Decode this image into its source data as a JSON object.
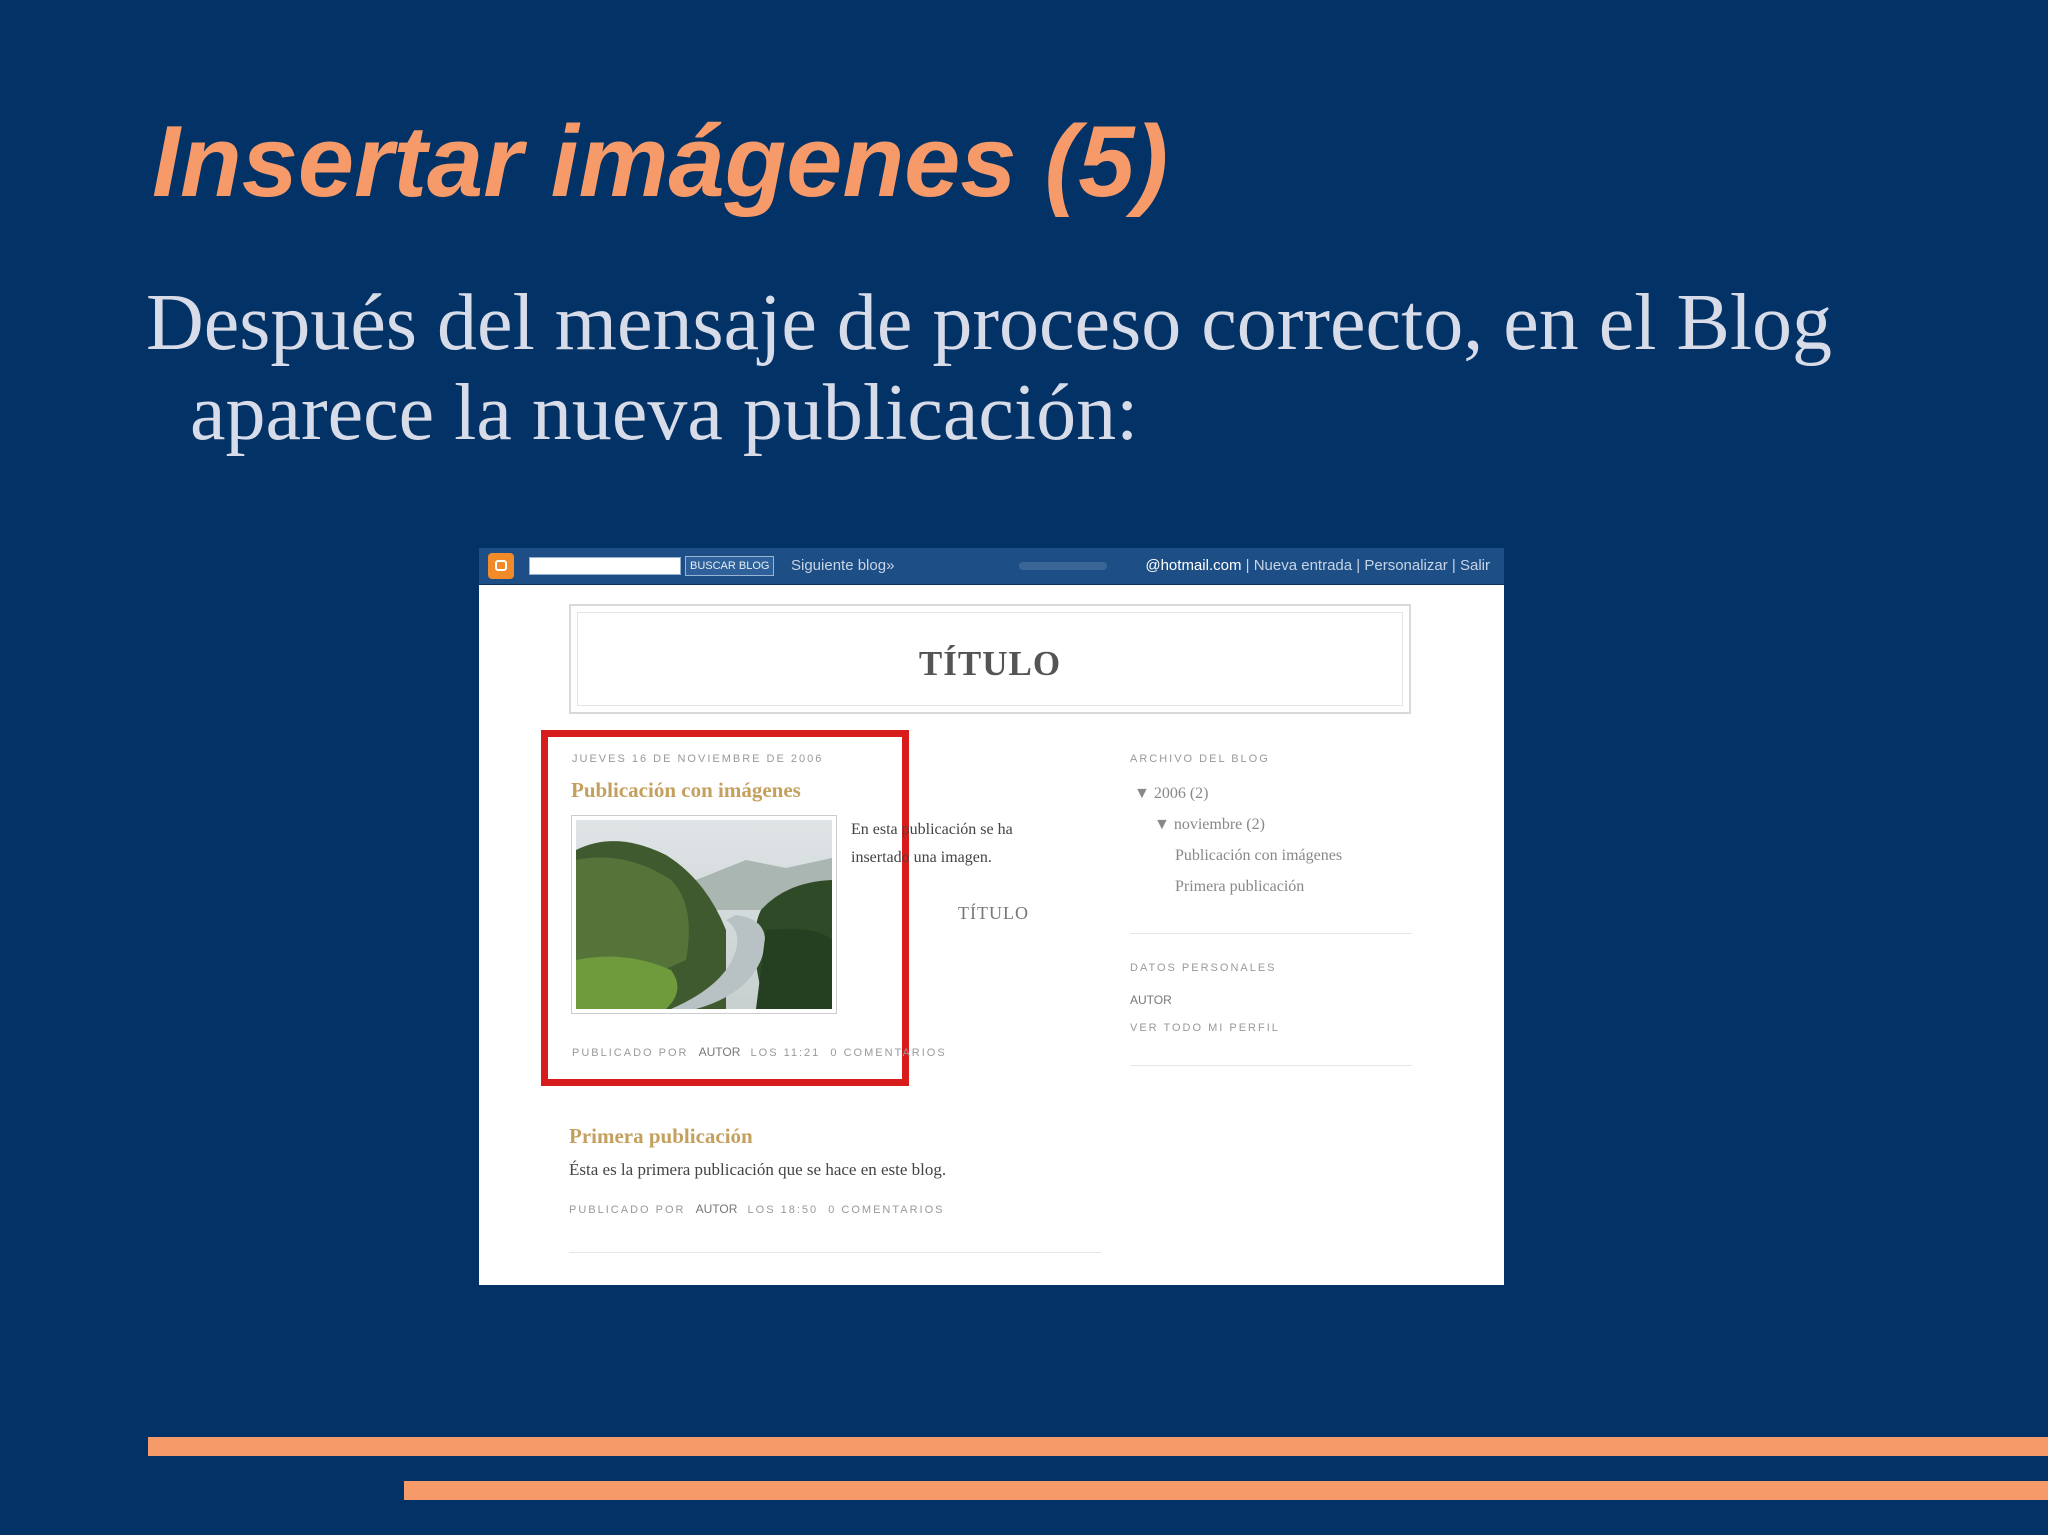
{
  "slide": {
    "title": "Insertar imágenes (5)",
    "body_line1": "Después del mensaje de proceso correcto, en el Blog",
    "body_line2": "aparece la nueva publicación:",
    "accent_color": "#f79a6a",
    "background_color": "#033266"
  },
  "blog": {
    "navbar": {
      "logo_icon": "blogger-logo-icon",
      "search_button": "BUSCAR BLOG",
      "next_blog": "Siguiente blog»",
      "email": "@hotmail.com",
      "links": [
        "Nueva entrada",
        "Personalizar",
        "Salir"
      ],
      "separator": "|"
    },
    "title": "TÍTULO",
    "post1": {
      "date": "JUEVES 16 DE NOVIEMBRE DE 2006",
      "title": "Publicación con imágenes",
      "text": "En esta publicación se ha insertado una imagen.",
      "signature": "TÍTULO",
      "footer_prefix": "PUBLICADO POR",
      "author": "AUTOR",
      "time": "LOS 11:21",
      "comments": "0 COMENTARIOS",
      "highlight_color": "#d81c1c"
    },
    "post2": {
      "title": "Primera publicación",
      "text": "Ésta es la primera publicación que se hace en este blog.",
      "footer_prefix": "PUBLICADO POR",
      "author": "AUTOR",
      "time": "LOS 18:50",
      "comments": "0 COMENTARIOS"
    },
    "sidebar": {
      "archive_heading": "ARCHIVO DEL BLOG",
      "year": "▼ 2006 (2)",
      "month": "▼ noviembre (2)",
      "posts": [
        "Publicación con imágenes",
        "Primera publicación"
      ],
      "profile_heading": "DATOS PERSONALES",
      "author": "AUTOR",
      "profile_link": "VER TODO MI PERFIL"
    }
  }
}
